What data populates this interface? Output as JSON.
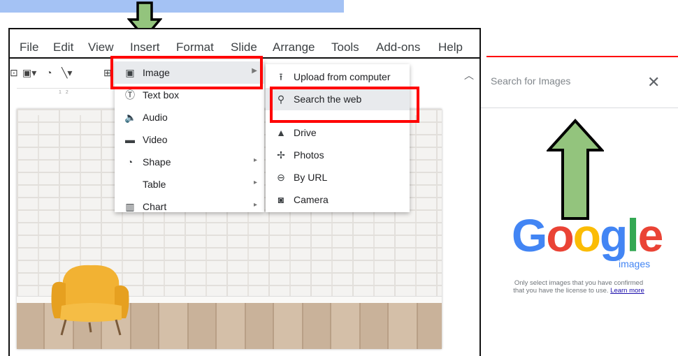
{
  "menubar": {
    "items": [
      "File",
      "Edit",
      "View",
      "Insert",
      "Format",
      "Slide",
      "Arrange",
      "Tools",
      "Add-ons",
      "Help"
    ]
  },
  "ruler": {
    "ticks": "1 2"
  },
  "insert_menu": {
    "items": [
      {
        "label": "Image",
        "icon": "image-icon",
        "submenu": true
      },
      {
        "label": "Text box",
        "icon": "text-box-icon",
        "submenu": false
      },
      {
        "label": "Audio",
        "icon": "audio-icon",
        "submenu": false
      },
      {
        "label": "Video",
        "icon": "video-icon",
        "submenu": false
      },
      {
        "label": "Shape",
        "icon": "shape-icon",
        "submenu": true
      },
      {
        "label": "Table",
        "icon": "",
        "submenu": true
      },
      {
        "label": "Chart",
        "icon": "chart-icon",
        "submenu": true
      }
    ]
  },
  "image_submenu": {
    "items": [
      {
        "label": "Upload from computer",
        "icon": "upload-icon"
      },
      {
        "label": "Search the web",
        "icon": "search-icon"
      },
      {
        "label": "Drive",
        "icon": "drive-icon"
      },
      {
        "label": "Photos",
        "icon": "photos-icon"
      },
      {
        "label": "By URL",
        "icon": "link-icon"
      },
      {
        "label": "Camera",
        "icon": "camera-icon"
      }
    ]
  },
  "search_panel": {
    "placeholder": "Search for Images",
    "logo": "Google",
    "logo_sub": "images",
    "license_text": "Only select images that you have confirmed that you have the license to use.",
    "learn_more": "Learn more"
  },
  "colors": {
    "highlight_box": "#ff0000",
    "arrow_fill": "#93c47d",
    "banner": "#a4c2f4",
    "google_blue": "#4285f4",
    "google_red": "#ea4335",
    "google_yellow": "#fbbc05",
    "google_green": "#34a853"
  }
}
